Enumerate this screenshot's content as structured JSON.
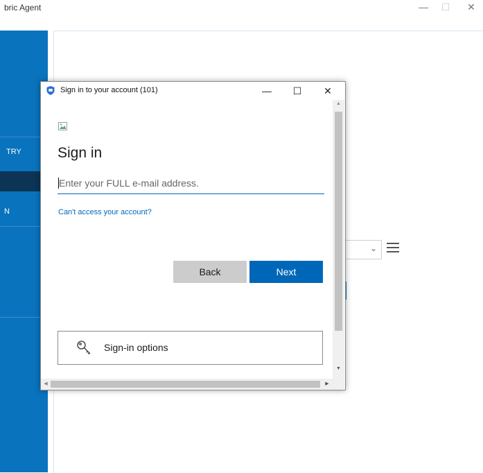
{
  "background_app": {
    "title": "bric Agent",
    "controls": {
      "minimize": "—",
      "maximize": "☐",
      "close": "✕"
    },
    "sidebar": {
      "item_1": "TRY",
      "item_2": "N"
    }
  },
  "dialog": {
    "title": "Sign in to your account (101)",
    "controls": {
      "minimize": "—",
      "maximize": "☐",
      "close": "✕"
    },
    "heading": "Sign in",
    "email_placeholder": "Enter your FULL e-mail address.",
    "cant_access_link": "Can't access your account?",
    "back_button": "Back",
    "next_button": "Next",
    "signin_options_button": "Sign-in options"
  },
  "colors": {
    "accent": "#0067b8",
    "sidebar": "#0a73bd",
    "sidebar_selected": "#0c3454",
    "secondary_button": "#cccccc"
  },
  "icons": [
    "shield-icon",
    "broken-image-icon",
    "key-icon",
    "chevron-down-icon",
    "hamburger-menu-icon"
  ]
}
